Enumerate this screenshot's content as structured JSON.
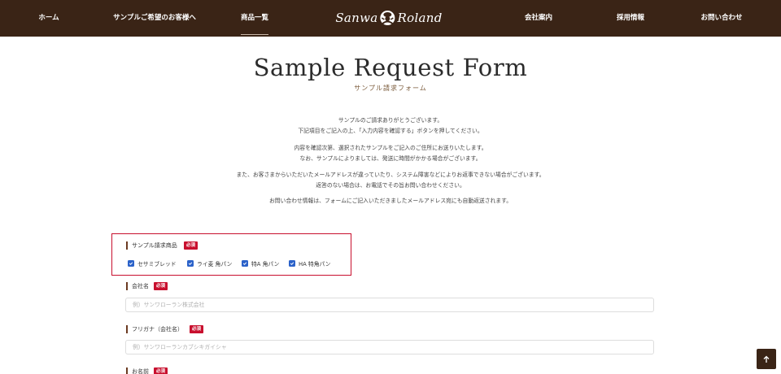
{
  "nav": {
    "home": "ホーム",
    "sample_customers": "サンプルご希望のお客様へ",
    "products": "商品一覧",
    "logo_text_left": "Sanwa",
    "logo_text_right": "Roland",
    "company": "会社案内",
    "recruit": "採用情報",
    "contact": "お問い合わせ",
    "active": "products"
  },
  "header": {
    "title": "Sample Request Form",
    "subtitle": "サンプル請求フォーム"
  },
  "intro": [
    "サンプルのご請求ありがとうございます。",
    "下記項目をご記入の上、「入力内容を確認する」ボタンを押してください。",
    "内容を確認次第、選択されたサンプルをご記入のご住所にお送りいたします。",
    "なお、サンプルによりましては、発送に時間がかかる場合がございます。",
    "また、お客さまからいただいたメールアドレスが違っていたり、システム障害などによりお返事できない場合がございます。",
    "返答のない場合は、お電話でその旨お問い合わせください。",
    "お問い合わせ情報は、フォームにご記入いただきましたメールアドレス宛にも自動返送されます。"
  ],
  "form": {
    "required_badge": "必須",
    "sample_products": {
      "label": "サンプル請求商品",
      "options": [
        {
          "label": "セサミブレッド",
          "checked": true
        },
        {
          "label": "ライ麦 角パン",
          "checked": true
        },
        {
          "label": "特A 角パン",
          "checked": true
        },
        {
          "label": "HA 特角パン",
          "checked": true
        }
      ]
    },
    "company_name": {
      "label": "会社名",
      "placeholder": "例）サンワローラン株式会社"
    },
    "company_kana": {
      "label": "フリガナ（会社名）",
      "placeholder": "例）サンワローランカブシキガイシャ"
    },
    "name": {
      "label": "お名前"
    }
  },
  "colors": {
    "nav_bg": "#3a2416",
    "accent_red": "#c8102e",
    "checkbox_blue": "#2b62c9",
    "label_bar": "#6b3a22"
  },
  "icons": {
    "logo_mark": "chef-mascot-icon",
    "checkbox": "check-icon",
    "back_to_top": "arrow-up-icon"
  }
}
